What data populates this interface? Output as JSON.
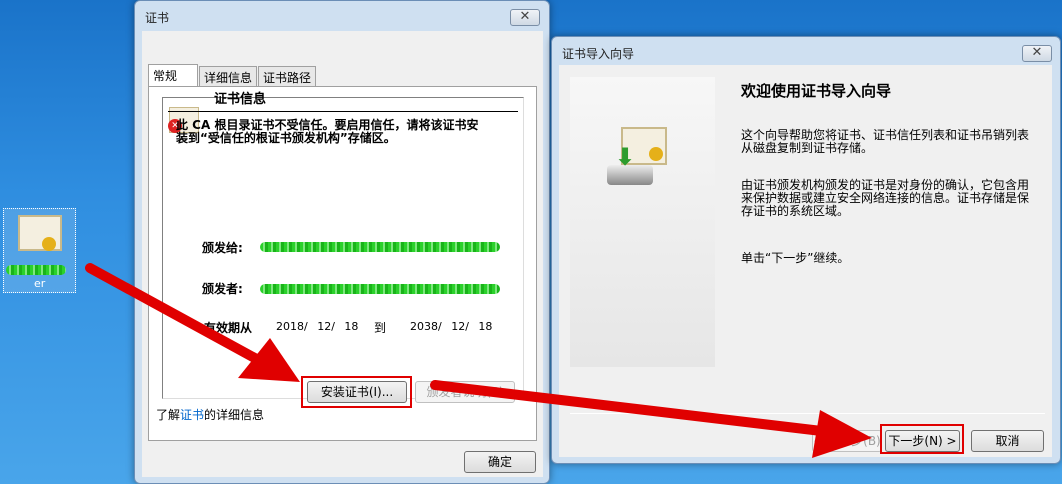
{
  "desktop": {
    "icon_label_suffix": "er"
  },
  "cert_dialog": {
    "title": "证书",
    "tabs": [
      "常规",
      "详细信息",
      "证书路径"
    ],
    "heading": "证书信息",
    "warning": "此 CA 根目录证书不受信任。要启用信任，请将该证书安装到“受信任的根证书颁发机构”存储区。",
    "issued_to_label": "颁发给:",
    "issued_by_label": "颁发者:",
    "valid_from_label": "有效期从",
    "valid_from": "2018/ 12/ 18",
    "to_label": "到",
    "valid_to": "2038/ 12/ 18",
    "install_button": "安装证书(I)...",
    "issuer_statement_button": "颁发者说明(S)",
    "learn_prefix": "了解",
    "learn_link": "证书",
    "learn_suffix": "的详细信息",
    "ok_button": "确定"
  },
  "wizard": {
    "title": "证书导入向导",
    "heading": "欢迎使用证书导入向导",
    "para1": "这个向导帮助您将证书、证书信任列表和证书吊销列表从磁盘复制到证书存储。",
    "para2": "由证书颁发机构颁发的证书是对身份的确认，它包含用来保护数据或建立安全网络连接的信息。证书存储是保存证书的系统区域。",
    "para3": "单击“下一步”继续。",
    "back_button": "< 上一步(B)",
    "next_button": "下一步(N) >",
    "cancel_button": "取消"
  },
  "colors": {
    "annotation": "#e00000",
    "link": "#0066cc"
  }
}
